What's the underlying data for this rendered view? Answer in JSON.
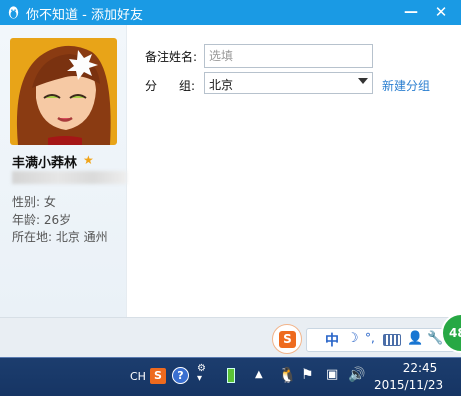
{
  "window": {
    "title": "你不知道 - 添加好友",
    "minimize_label": "—",
    "close_label": "✕"
  },
  "profile": {
    "nickname": "丰满小莽林",
    "gender": "性别: 女",
    "age": "年龄: 26岁",
    "location": "所在地: 北京  通州"
  },
  "form": {
    "remark_label": "备注姓名:",
    "remark_placeholder": "选填",
    "group_label_a": "分",
    "group_label_b": "组:",
    "group_value": "北京",
    "new_group_link": "新建分组"
  },
  "ime": {
    "logo": "S",
    "mode": "中",
    "moon": "☽",
    "dot": "°,",
    "user": "👤",
    "wrench": "🔧",
    "badge": "48"
  },
  "taskbar": {
    "lang": "CH",
    "sogou": "S",
    "help": "?",
    "time": "22:45",
    "date": "2015/11/23"
  },
  "colors": {
    "titlebar": "#1a9ae4",
    "link": "#2b7fd0",
    "star": "#f0a418",
    "taskbar": "#1c3d6e"
  }
}
